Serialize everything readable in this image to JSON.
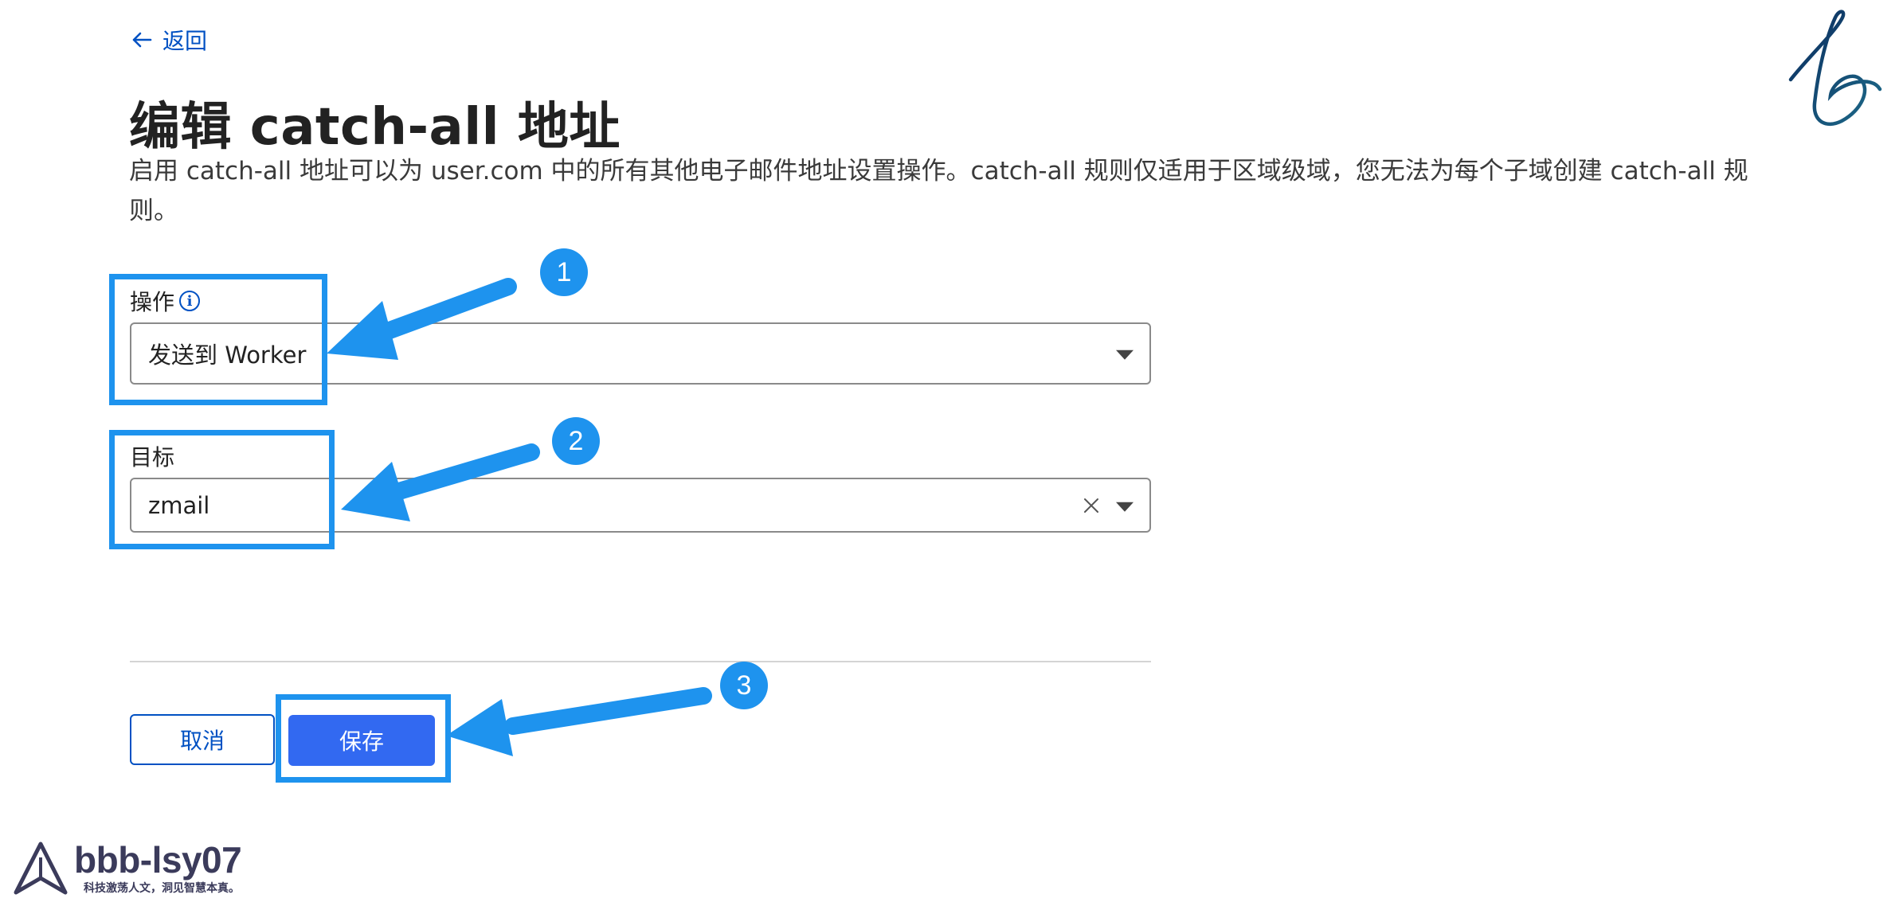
{
  "nav": {
    "back_label": "返回"
  },
  "header": {
    "title": "编辑 catch-all 地址",
    "description": "启用 catch-all 地址可以为 user.com 中的所有其他电子邮件地址设置操作。catch-all 规则仅适用于区域级域，您无法为每个子域创建 catch-all 规则。"
  },
  "form": {
    "action": {
      "label": "操作",
      "info_icon": "info-icon",
      "value": "发送到 Worker"
    },
    "target": {
      "label": "目标",
      "value": "zmail",
      "clear_icon": "close-icon"
    }
  },
  "buttons": {
    "cancel": "取消",
    "save": "保存"
  },
  "annotations": {
    "step1": "1",
    "step2": "2",
    "step3": "3",
    "color": "#1e93ee"
  },
  "watermark": {
    "name": "bbb-lsy07",
    "slogan": "科技激荡人文，洞见智慧本真。",
    "logo_icon": "triangle-logo-icon",
    "signature_icon": "signature-b-icon"
  },
  "colors": {
    "link": "#0051c3",
    "primary": "#3269f1",
    "border": "#8a8a8a"
  }
}
